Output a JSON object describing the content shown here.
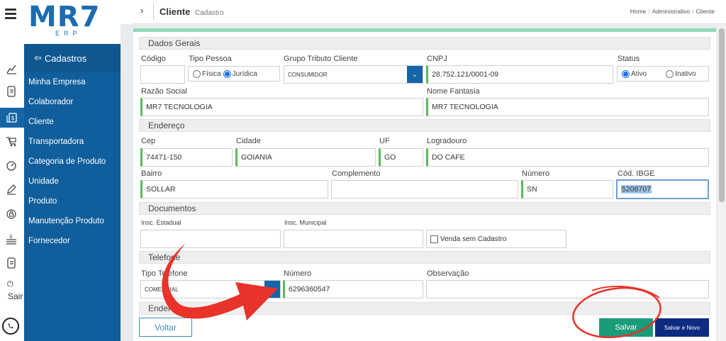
{
  "logo": {
    "main": "MR7",
    "sub": "ERP"
  },
  "sidebar": {
    "header": "Cadastros",
    "items": [
      {
        "label": "Minha Empresa"
      },
      {
        "label": "Colaborador"
      },
      {
        "label": "Cliente"
      },
      {
        "label": "Transportadora"
      },
      {
        "label": "Categoria de Produto"
      },
      {
        "label": "Unidade"
      },
      {
        "label": "Produto"
      },
      {
        "label": "Manutenção Produto"
      },
      {
        "label": "Fornecedor"
      }
    ],
    "sair_label": "Sair"
  },
  "header": {
    "title": "Cliente",
    "subtitle": "Cadastro",
    "breadcrumb": [
      "Home",
      "Administrativo",
      "Cliente"
    ]
  },
  "sections": {
    "dados_gerais": "Dados Gerais",
    "endereco": "Endereço",
    "documentos": "Documentos",
    "telefone": "Telefone",
    "endereco2": "Endereço"
  },
  "form": {
    "codigo": {
      "label": "Código",
      "value": ""
    },
    "tipo_pessoa": {
      "label": "Tipo Pessoa",
      "options": [
        "Física",
        "Jurídica"
      ],
      "selected": "Jurídica"
    },
    "grupo_tributo": {
      "label": "Grupo Tributo Cliente",
      "value": "CONSUMIDOR"
    },
    "cnpj": {
      "label": "CNPJ",
      "value": "28.752.121/0001-09"
    },
    "status": {
      "label": "Status",
      "options": [
        "Ativo",
        "Inativo"
      ],
      "selected": "Ativo"
    },
    "razao_social": {
      "label": "Razão Social",
      "value": "MR7 TECNOLOGIA"
    },
    "nome_fantasia": {
      "label": "Nome Fantasia",
      "value": "MR7 TECNOLOGIA"
    },
    "cep": {
      "label": "Cep",
      "value": "74471-150"
    },
    "cidade": {
      "label": "Cidade",
      "value": "GOIANIA"
    },
    "uf": {
      "label": "UF",
      "value": "GO"
    },
    "logradouro": {
      "label": "Logradouro",
      "value": "DO CAFE"
    },
    "bairro": {
      "label": "Bairro",
      "value": "SOLLAR"
    },
    "complemento": {
      "label": "Complemento",
      "value": ""
    },
    "numero": {
      "label": "Número",
      "value": "SN"
    },
    "cod_ibge": {
      "label": "Cód. IBGE",
      "value": "5208707"
    },
    "insc_estadual": {
      "label": "Insc. Estadual",
      "value": ""
    },
    "insc_municipal": {
      "label": "Insc. Municipal",
      "value": ""
    },
    "venda_sem_cadastro": {
      "label": "Venda sem Cadastro",
      "checked": false
    },
    "tipo_telefone": {
      "label": "Tipo Telefone",
      "value": "COMERCIAL"
    },
    "tel_numero": {
      "label": "Número",
      "value": "6296360547"
    },
    "observacao": {
      "label": "Observação",
      "value": ""
    }
  },
  "buttons": {
    "voltar": "Voltar",
    "salvar": "Salvar",
    "salvar_novo": "Salvar e Novo"
  },
  "colors": {
    "brand": "#1565a7",
    "sidebar": "#105e9c",
    "accent_green": "#1a9b7a",
    "annotation_red": "#e8322a",
    "field_valid": "#5cb85c"
  }
}
